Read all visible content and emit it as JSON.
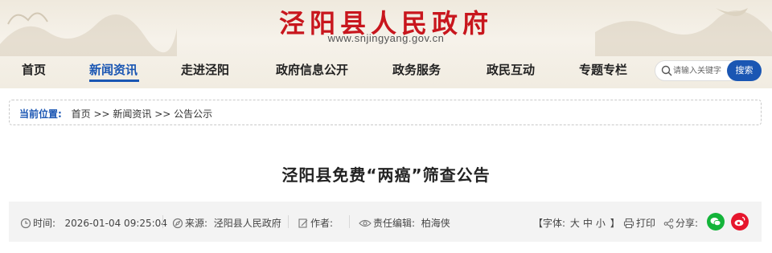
{
  "site": {
    "title": "泾阳县人民政府",
    "url": "www.snjingyang.gov.cn"
  },
  "nav": {
    "items": [
      {
        "label": "首页"
      },
      {
        "label": "新闻资讯"
      },
      {
        "label": "走进泾阳"
      },
      {
        "label": "政府信息公开"
      },
      {
        "label": "政务服务"
      },
      {
        "label": "政民互动"
      },
      {
        "label": "专题专栏"
      }
    ],
    "active_index": 1
  },
  "search": {
    "placeholder": "请输入关键字",
    "button_label": "搜索"
  },
  "breadcrumb": {
    "label": "当前位置:",
    "path": "首页 >> 新闻资讯 >> 公告公示"
  },
  "article": {
    "title": "泾阳县免费“两癌”筛查公告"
  },
  "meta": {
    "time_label": "时间:",
    "time_value": "2026-01-04 09:25:04",
    "source_label": "来源:",
    "source_value": "泾阳县人民政府",
    "author_label": "作者:",
    "author_value": "",
    "editor_label": "责任编辑:",
    "editor_value": "柏海侠",
    "font_label": "【字体:",
    "font_large": "大",
    "font_medium": "中",
    "font_small": "小",
    "font_close": "】",
    "print_label": "打印",
    "share_label": "分享:"
  },
  "colors": {
    "brand_red": "#c8161d",
    "accent_blue": "#1a56b3",
    "wechat_green": "#14b43a",
    "weibo_red": "#e6162d"
  }
}
